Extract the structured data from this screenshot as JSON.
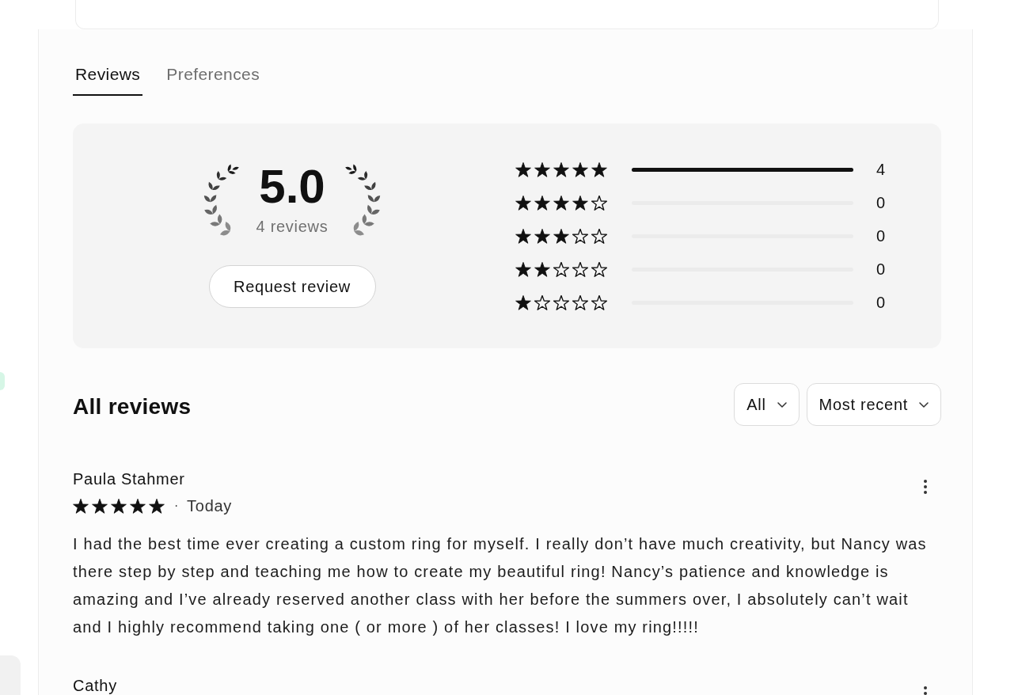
{
  "tabs": [
    {
      "label": "Reviews",
      "selected": true
    },
    {
      "label": "Preferences",
      "selected": false
    }
  ],
  "summary": {
    "average": "5.0",
    "review_count": "4 reviews",
    "request_button": "Request review",
    "distribution": [
      {
        "stars": 5,
        "level": 1,
        "count": "4"
      },
      {
        "stars": 4,
        "level": 0,
        "count": "0"
      },
      {
        "stars": 3,
        "level": 0,
        "count": "0"
      },
      {
        "stars": 2,
        "level": 0,
        "count": "0"
      },
      {
        "stars": 1,
        "level": 0,
        "count": "0"
      }
    ]
  },
  "all_reviews": {
    "title": "All reviews",
    "filters": [
      {
        "label": "All"
      },
      {
        "label": "Most recent"
      }
    ],
    "reviews": [
      {
        "author": "Paula Stahmer",
        "stars": 5,
        "separator": "·",
        "date": "Today",
        "text": "I had the best time ever creating a custom ring for myself. I really don’t have much creativity, but Nancy was there step by step and teaching me how to create my beautiful ring! Nancy’s patience and knowledge is amazing and I’ve already reserved another class with her before the summers over, I absolutely can’t wait and I highly recommend taking one ( or more ) of her classes! I love my ring!!!!!"
      },
      {
        "author": "Cathy"
      }
    ]
  }
}
